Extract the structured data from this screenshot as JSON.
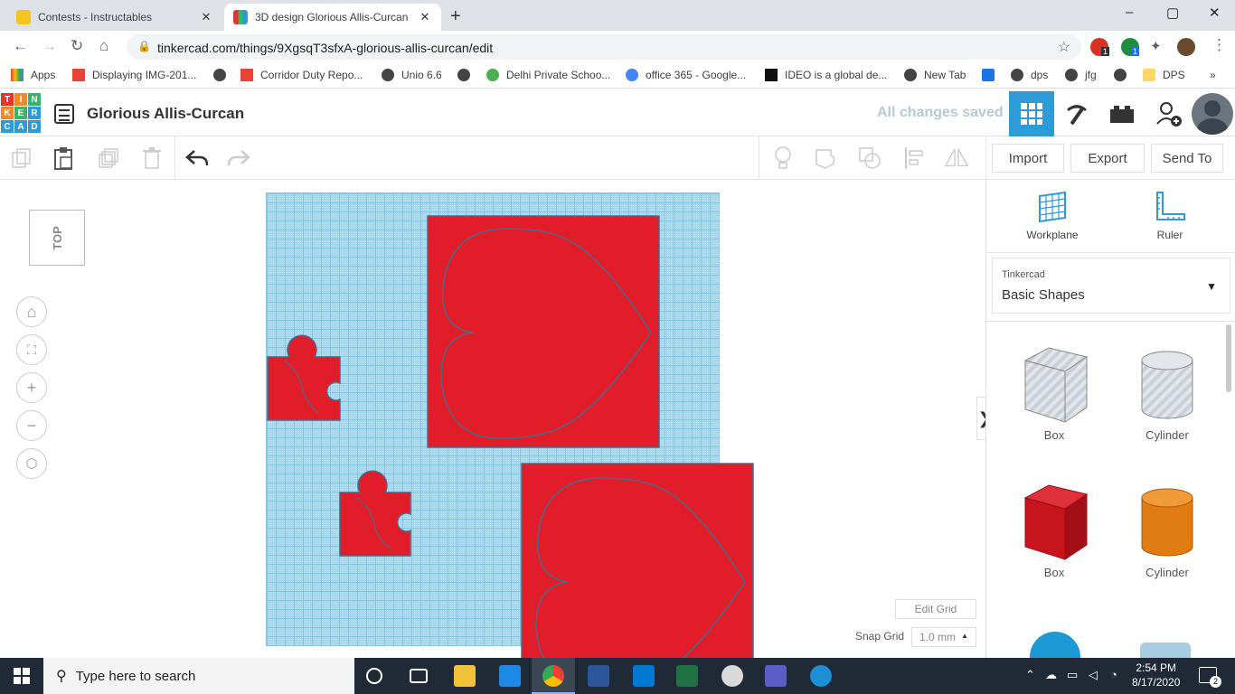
{
  "browser": {
    "tabs": [
      {
        "title": "Contests - Instructables",
        "active": false
      },
      {
        "title": "3D design Glorious Allis-Curcan",
        "active": true
      }
    ],
    "url": "tinkercad.com/things/9XgsqT3sfxA-glorious-allis-curcan/edit",
    "bookmarks": [
      "Apps",
      "Displaying IMG-201...",
      "Corridor Duty Repo...",
      "Unio 6.6",
      "Delhi Private Schoo...",
      "office 365 - Google...",
      "IDEO is a global de...",
      "New Tab",
      "dps",
      "jfg",
      "DPS"
    ],
    "bookmarks_more": "»",
    "new_tab": "+",
    "window_controls": {
      "minimize": "–",
      "maximize": "▢",
      "close": "✕"
    },
    "ext_badge_1": "1",
    "ext_badge_2": "1"
  },
  "app": {
    "logo_letters": [
      "T",
      "I",
      "N",
      "K",
      "E",
      "R",
      "C",
      "A",
      "D"
    ],
    "design_title": "Glorious Allis-Curcan",
    "save_status": "All changes saved"
  },
  "toolbar": {
    "import_label": "Import",
    "export_label": "Export",
    "sendto_label": "Send To"
  },
  "workspace": {
    "viewcube_label": "TOP",
    "edit_grid_label": "Edit Grid",
    "snap_grid_label": "Snap Grid",
    "snap_grid_value": "1.0 mm",
    "snap_arrow": "▲",
    "collapse_arrow": "❯"
  },
  "panel": {
    "workplane_label": "Workplane",
    "ruler_label": "Ruler",
    "library_category": "Tinkercad",
    "library_value": "Basic Shapes",
    "library_arrow": "▼",
    "shapes": [
      {
        "label": "Box",
        "color": "#c9cfd6"
      },
      {
        "label": "Cylinder",
        "color": "#c9cfd6"
      },
      {
        "label": "Box",
        "color": "#d7141e"
      },
      {
        "label": "Cylinder",
        "color": "#e07c12"
      }
    ]
  },
  "colors": {
    "shape_red": "#e21d2a",
    "outline": "#4a6a8a",
    "grid_bg": "#bfe3f0",
    "tinkercad_blue": "#2d9bd6"
  },
  "taskbar": {
    "search_placeholder": "Type here to search",
    "time": "2:54 PM",
    "date": "8/17/2020",
    "notifications": "2"
  }
}
